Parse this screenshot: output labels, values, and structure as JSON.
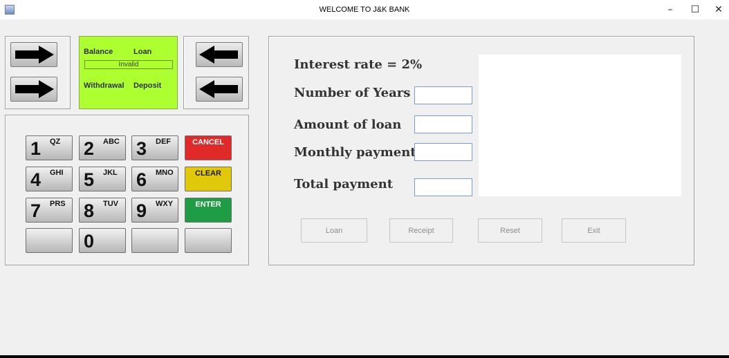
{
  "window": {
    "title": "WELCOME TO J&K BANK",
    "minimize_glyph": "–",
    "maximize_glyph": "☐",
    "close_glyph": "✕"
  },
  "atm": {
    "screen_color": "#adff2f",
    "screen": {
      "balance": "Balance",
      "loan": "Loan",
      "status": "Invalid",
      "withdrawal": "Withdrawal",
      "deposit": "Deposit"
    },
    "side_buttons": {
      "left": [
        "arrow-right-icon",
        "arrow-right-icon"
      ],
      "right": [
        "arrow-left-icon",
        "arrow-left-icon"
      ]
    },
    "keypad": [
      {
        "digit": "1",
        "letters": "QZ"
      },
      {
        "digit": "2",
        "letters": "ABC"
      },
      {
        "digit": "3",
        "letters": "DEF"
      },
      {
        "word": "CANCEL",
        "color": "#e02a2a"
      },
      {
        "digit": "4",
        "letters": "GHI"
      },
      {
        "digit": "5",
        "letters": "JKL"
      },
      {
        "digit": "6",
        "letters": "MNO"
      },
      {
        "word": "CLEAR",
        "color": "#e0c80a"
      },
      {
        "digit": "7",
        "letters": "PRS"
      },
      {
        "digit": "8",
        "letters": "TUV"
      },
      {
        "digit": "9",
        "letters": "WXY"
      },
      {
        "word": "ENTER",
        "color": "#1f9d45"
      },
      {
        "digit": "",
        "letters": ""
      },
      {
        "digit": "0",
        "letters": ""
      },
      {
        "digit": "",
        "letters": ""
      },
      {
        "digit": "",
        "letters": ""
      }
    ]
  },
  "loan_form": {
    "interest_rate": "Interest rate   =  2%",
    "years_label": "Number of Years",
    "years_value": "",
    "amount_label": "Amount of loan",
    "amount_value": "",
    "monthly_label": "Monthly payment",
    "monthly_value": "",
    "total_label": "Total payment",
    "total_value": "",
    "output_text": ""
  },
  "actions": {
    "loan": "Loan",
    "receipt": "Receipt",
    "reset": "Reset",
    "exit": "Exit"
  }
}
